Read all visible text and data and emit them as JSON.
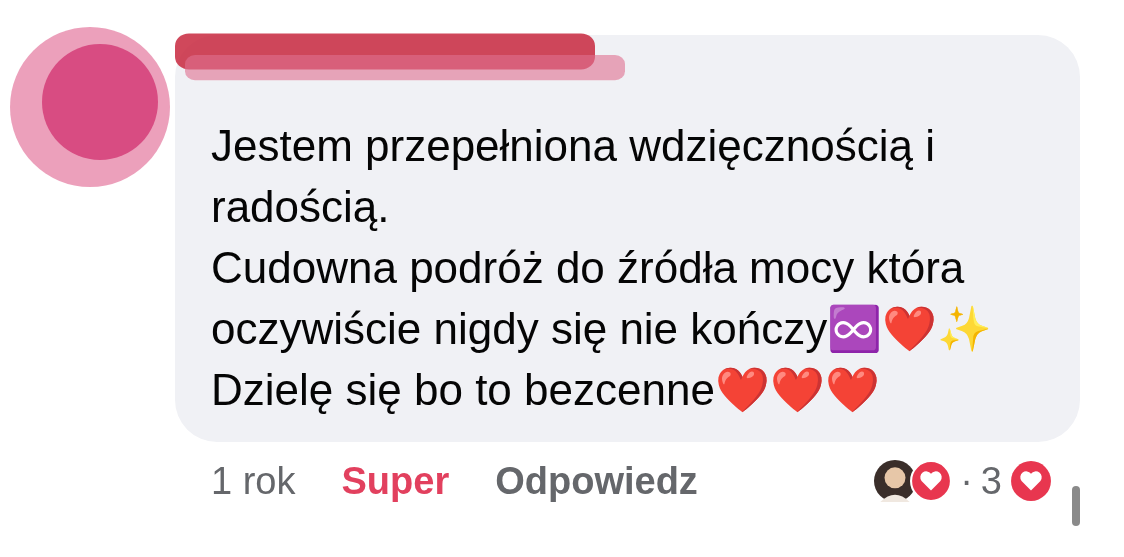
{
  "comment": {
    "paragraphs": [
      "Jestem przepełniona wdzięcznością i radością.",
      "Cudowna podróż do źródła mocy która oczywiście nigdy się nie kończy♾️❤️✨",
      "Dzielę się bo to bezcenne❤️❤️❤️"
    ]
  },
  "footer": {
    "time": "1 rok",
    "actions": [
      {
        "label": "Super",
        "selected": true
      },
      {
        "label": "Odpowiedz",
        "selected": false
      }
    ],
    "separator": "·",
    "reaction_count": "3"
  }
}
